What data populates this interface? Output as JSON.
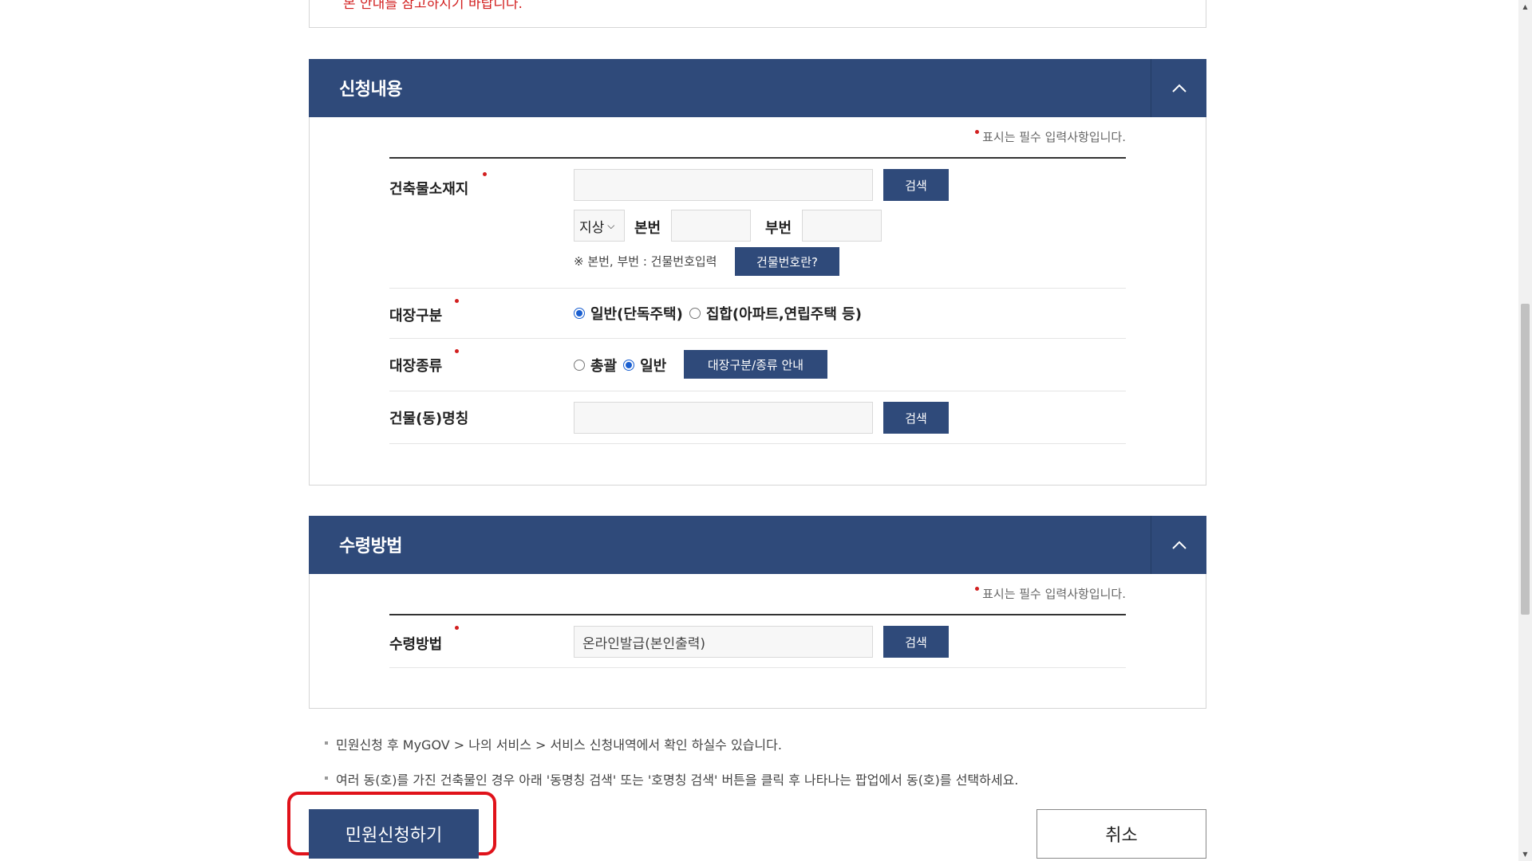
{
  "prev_section": {
    "note": "본 안내를 참고하시기 바랍니다."
  },
  "section_apply": {
    "title": "신청내용",
    "required_note": "표시는 필수 입력사항입니다.",
    "building_location": {
      "label": "건축물소재지",
      "address_value": "",
      "search_label": "검색",
      "land_type": "지상",
      "main_no_label": "본번",
      "main_no_value": "",
      "sub_no_label": "부번",
      "sub_no_value": "",
      "hint": "※ 본번, 부번 : 건물번호입력",
      "help_button": "건물번호란?"
    },
    "register_type": {
      "label": "대장구분",
      "options": [
        "일반(단독주택)",
        "집합(아파트,연립주택 등)"
      ],
      "selected": "일반(단독주택)"
    },
    "register_kind": {
      "label": "대장종류",
      "options": [
        "총괄",
        "일반"
      ],
      "selected": "일반",
      "guide_button": "대장구분/종류 안내"
    },
    "building_name": {
      "label": "건물(동)명칭",
      "value": "",
      "search_label": "검색"
    }
  },
  "section_receive": {
    "title": "수령방법",
    "required_note": "표시는 필수 입력사항입니다.",
    "receive_method": {
      "label": "수령방법",
      "value": "온라인발급(본인출력)",
      "search_label": "검색"
    }
  },
  "notes": [
    "민원신청 후 MyGOV > 나의 서비스 > 서비스 신청내역에서 확인 하실수 있습니다.",
    "여러 동(호)를 가진 건축물인 경우 아래 '동명칭 검색' 또는 '호명칭 검색' 버튼을 클릭 후 나타나는 팝업에서 동(호)를 선택하세요."
  ],
  "actions": {
    "submit": "민원신청하기",
    "cancel": "취소"
  },
  "colors": {
    "header": "#2f4a7a",
    "required_dot": "#d21f1f",
    "highlight": "#e0121a"
  }
}
